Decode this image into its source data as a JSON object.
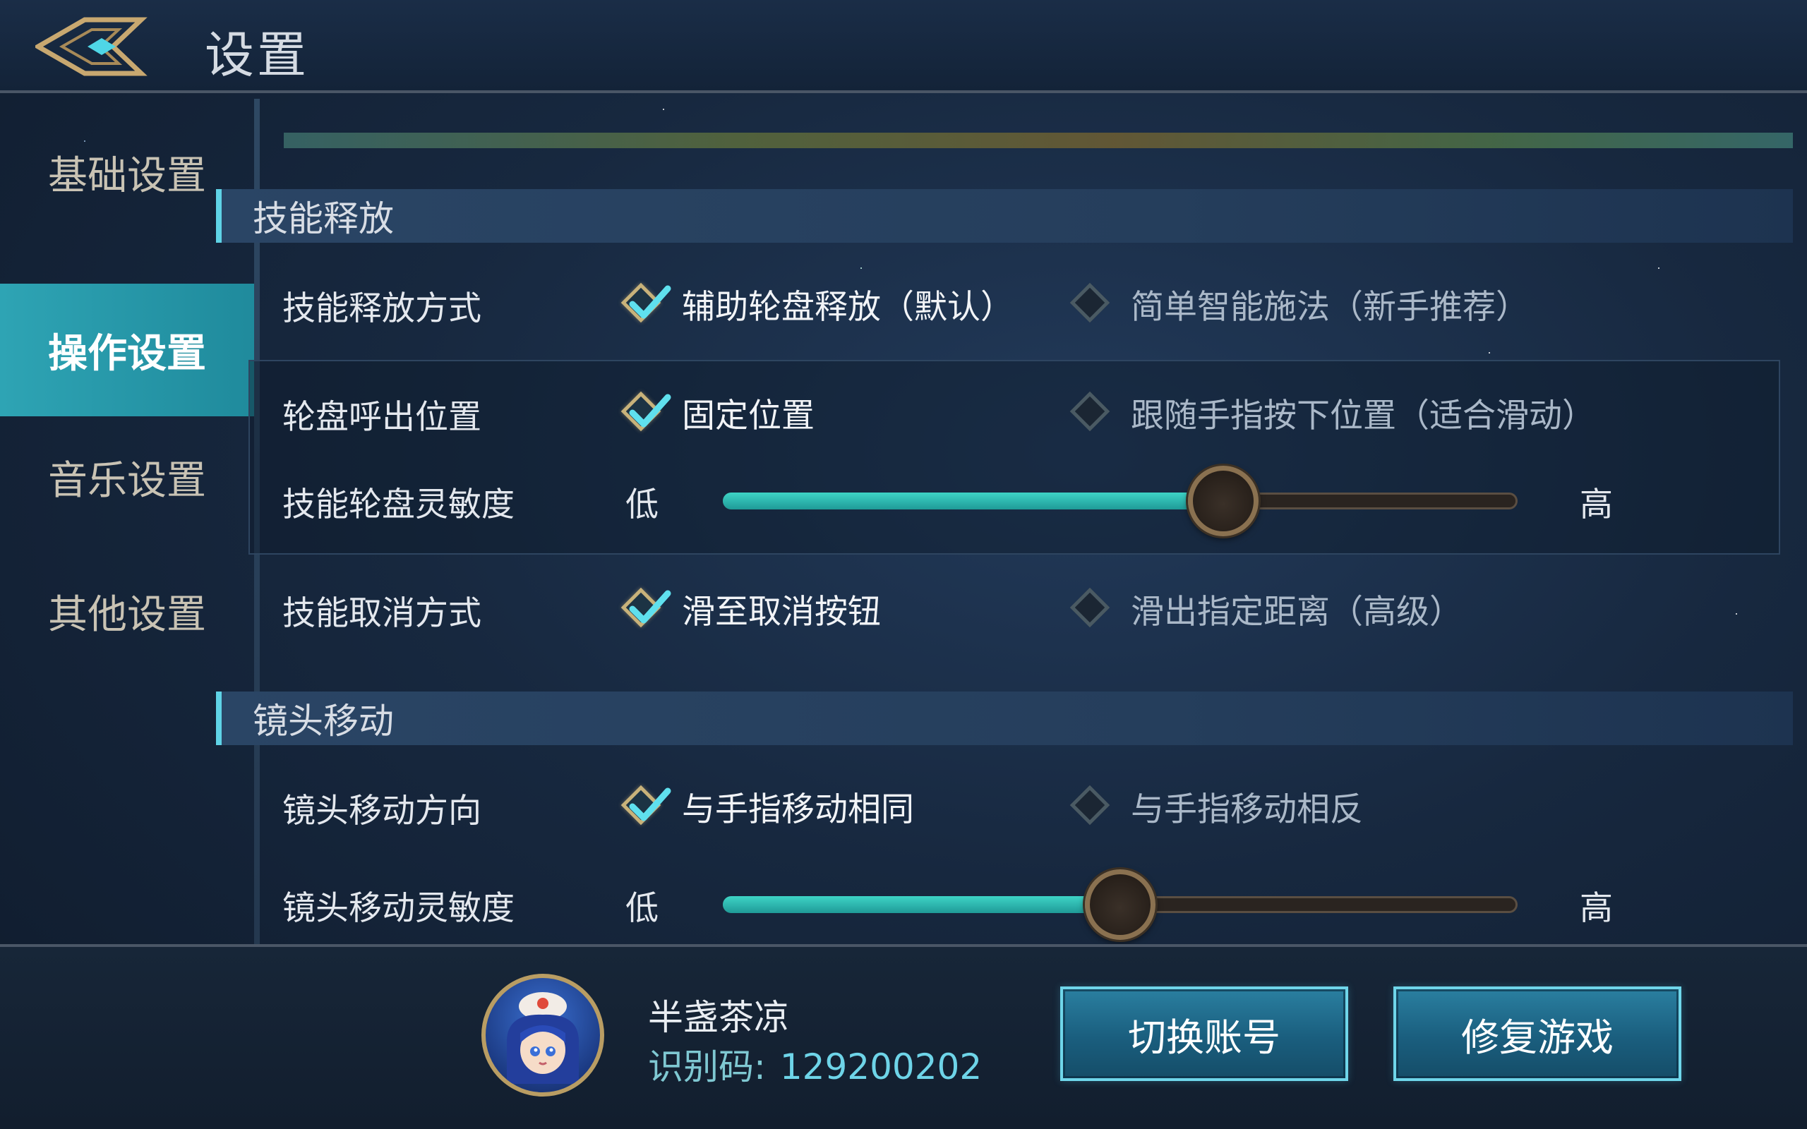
{
  "header": {
    "title": "设置",
    "back_icon": "back-arrow-icon"
  },
  "sidebar": {
    "items": [
      {
        "label": "基础设置",
        "active": false
      },
      {
        "label": "操作设置",
        "active": true
      },
      {
        "label": "音乐设置",
        "active": false
      },
      {
        "label": "其他设置",
        "active": false
      }
    ]
  },
  "sections": {
    "skill_release": {
      "title": "技能释放",
      "release_mode": {
        "label": "技能释放方式",
        "option_a": "辅助轮盘释放（默认）",
        "option_b": "简单智能施法（新手推荐）",
        "selected": "a"
      },
      "wheel_position": {
        "label": "轮盘呼出位置",
        "option_a": "固定位置",
        "option_b": "跟随手指按下位置（适合滑动）",
        "selected": "a"
      },
      "wheel_sensitivity": {
        "label": "技能轮盘灵敏度",
        "low": "低",
        "high": "高",
        "value": 0.63
      },
      "cancel_mode": {
        "label": "技能取消方式",
        "option_a": "滑至取消按钮",
        "option_b": "滑出指定距离（高级）",
        "selected": "a"
      }
    },
    "camera": {
      "title": "镜头移动",
      "direction": {
        "label": "镜头移动方向",
        "option_a": "与手指移动相同",
        "option_b": "与手指移动相反",
        "selected": "a"
      },
      "sensitivity": {
        "label": "镜头移动灵敏度",
        "low": "低",
        "high": "高",
        "value": 0.5
      }
    }
  },
  "footer": {
    "username": "半盏茶凉",
    "id_label": "识别码:",
    "id_value": "129200202",
    "switch_account": "切换账号",
    "repair_game": "修复游戏"
  },
  "colors": {
    "accent": "#2ea4b4",
    "slider_fill": "#3ed4c6",
    "check": "#5fe0ee",
    "gold": "#c8b27a"
  }
}
